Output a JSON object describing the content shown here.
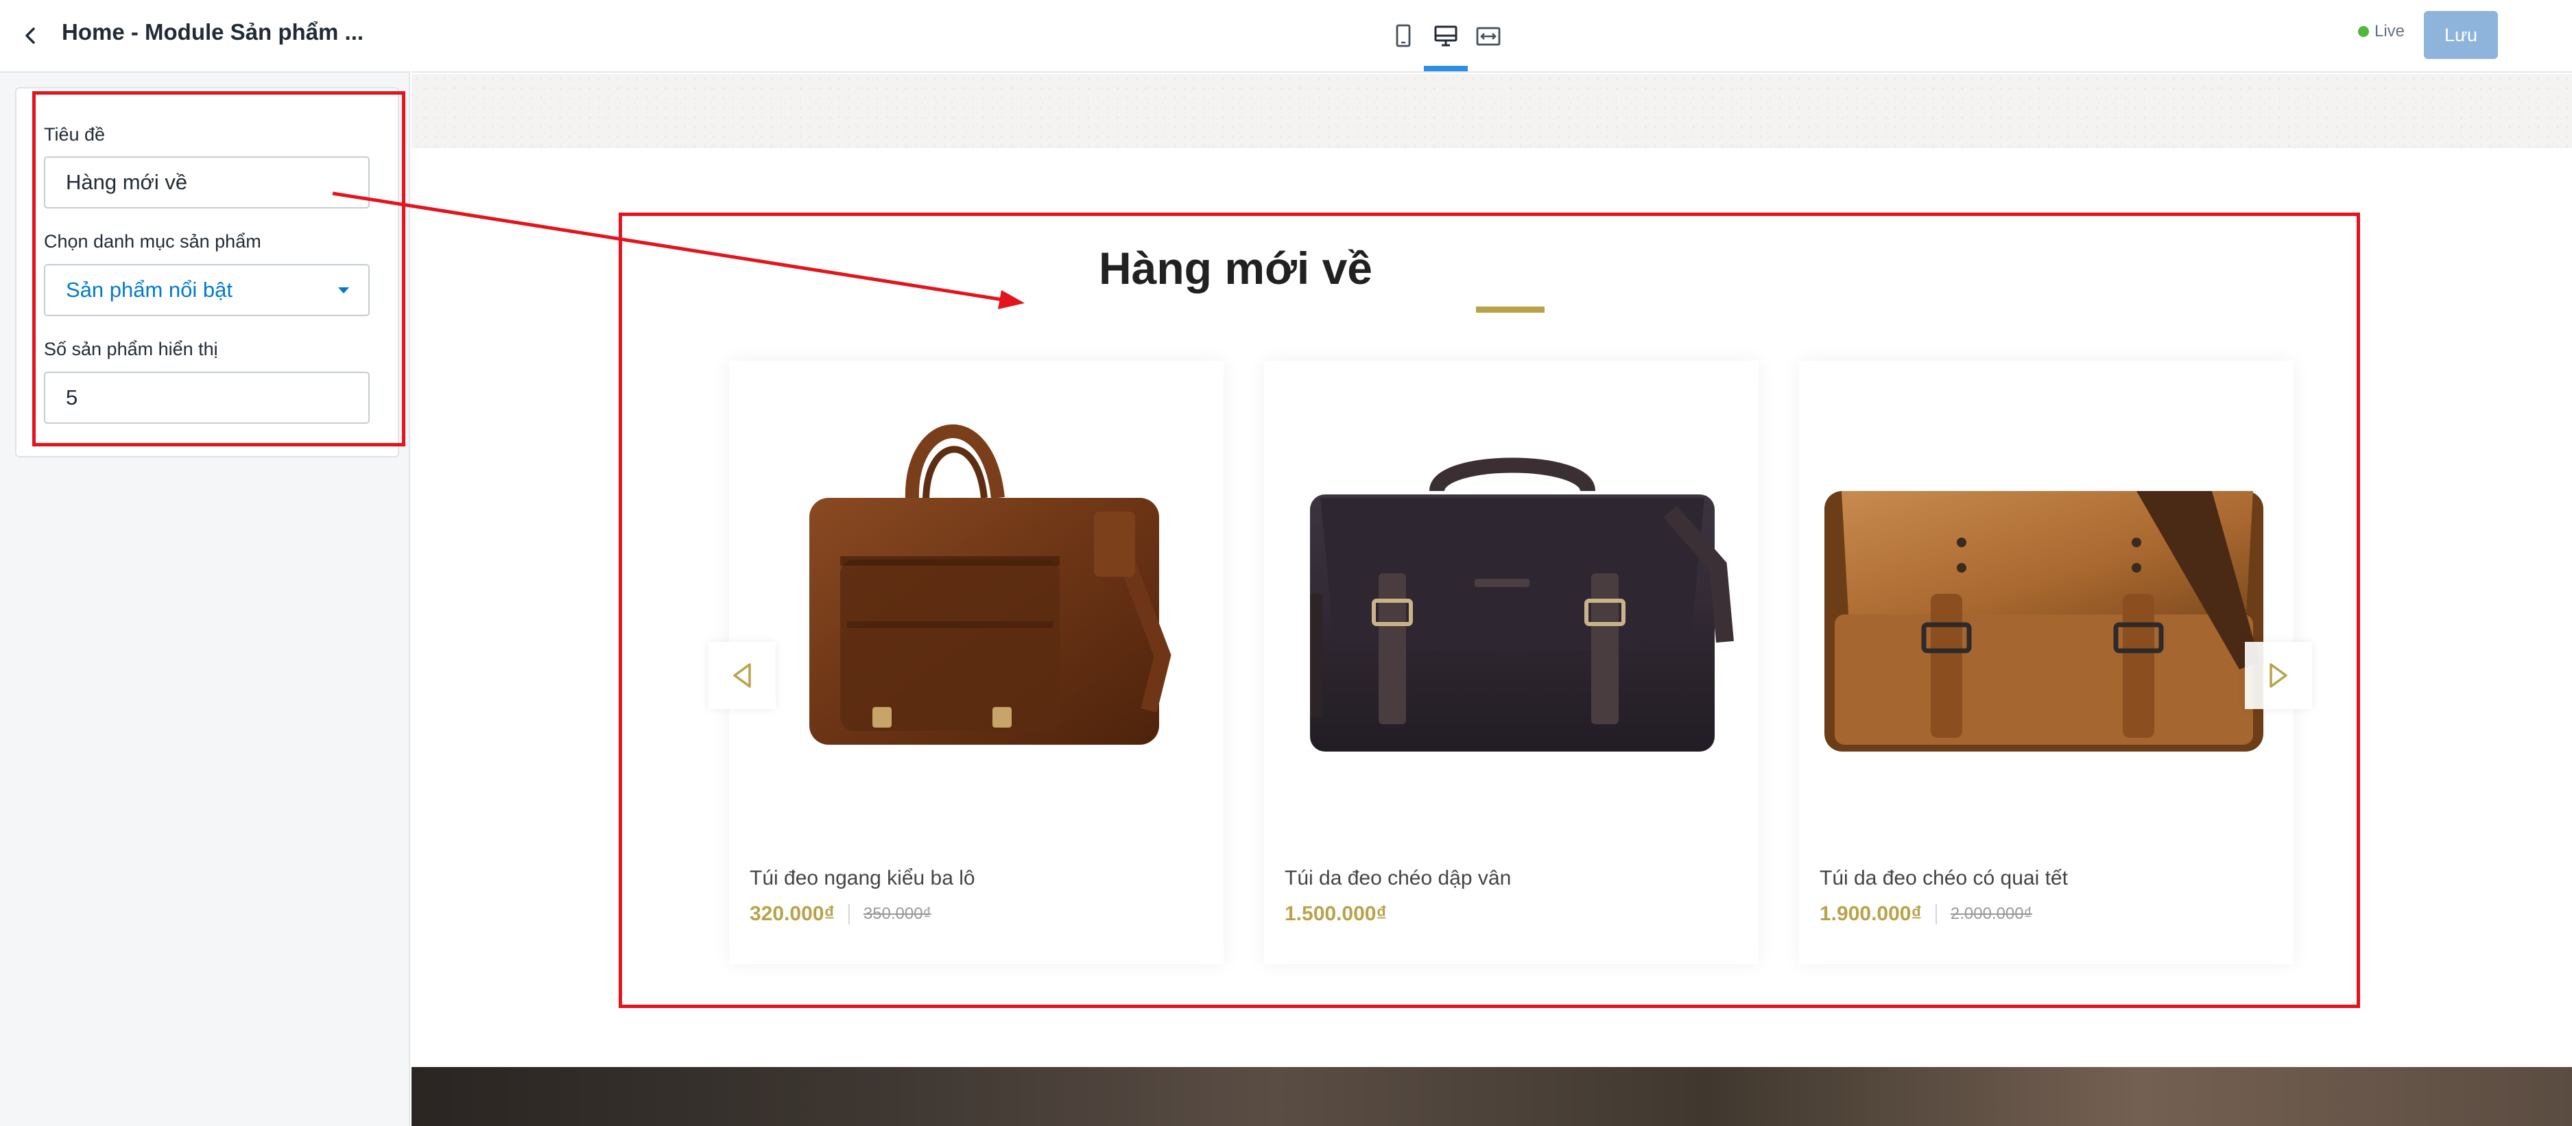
{
  "panel": {
    "title": "Home - Module Sản phẩm ...",
    "fields": {
      "title_label": "Tiêu đề",
      "title_value": "Hàng mới về",
      "category_label": "Chọn danh mục sản phẩm",
      "category_value": "Sản phẩm nổi bật",
      "count_label": "Số sản phẩm hiển thị",
      "count_value": "5"
    }
  },
  "toolbar": {
    "devices": [
      "mobile-view-icon",
      "desktop-view-icon",
      "full-width-view-icon"
    ],
    "active_device": "desktop-view-icon",
    "live_label": "Live",
    "save_label": "Lưu"
  },
  "preview": {
    "section_title": "Hàng mới về",
    "products": [
      {
        "name": "Túi đeo ngang kiểu ba lô",
        "price": "320.000₫",
        "old_price": "350.000₫"
      },
      {
        "name": "Túi da đeo chéo dập vân",
        "price": "1.500.000₫",
        "old_price": ""
      },
      {
        "name": "Túi da đeo chéo có quai tết",
        "price": "1.900.000₫",
        "old_price": "2.000.000₫"
      }
    ]
  },
  "colors": {
    "accent_gold": "#b8a34a",
    "annotation_red": "#e3141d",
    "link_blue": "#007ace",
    "live_green": "#50b83c",
    "save_button": "#8fb4dc"
  }
}
